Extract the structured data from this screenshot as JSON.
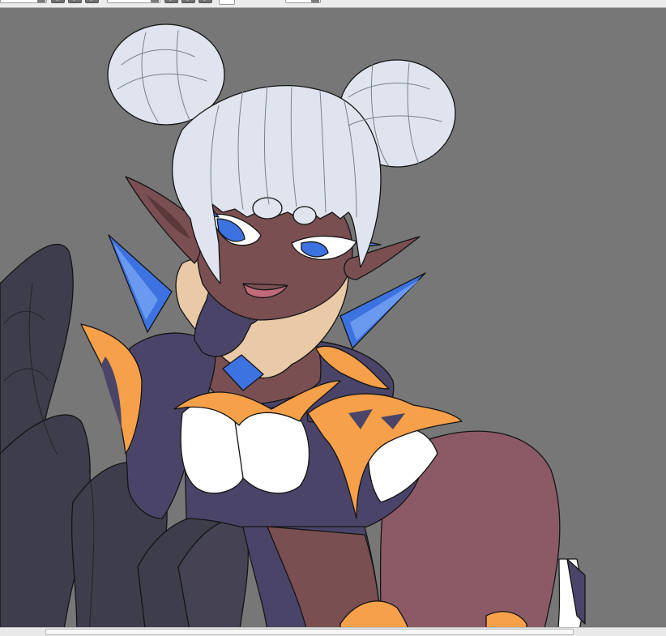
{
  "app": {
    "toolbar": {
      "size_field_value": "",
      "zoom_field_value": ""
    },
    "canvas": {
      "background_color": "#777777",
      "artwork": "illustration-dark-elf-character-flat-colors"
    },
    "icons": [
      "chevron-down-icon",
      "confirm-icon",
      "tool-icon"
    ],
    "colors": {
      "hair": "#dfe4ee",
      "skin": "#7a4f52",
      "legs": "#8c5a66",
      "outfit": "#4a4568",
      "gold_trim": "#f6a04a",
      "crystal": "#3d73e0",
      "white_cloth": "#ffffff",
      "collar": "#e9c9a6",
      "tentacles": "#3e3d4c"
    }
  }
}
